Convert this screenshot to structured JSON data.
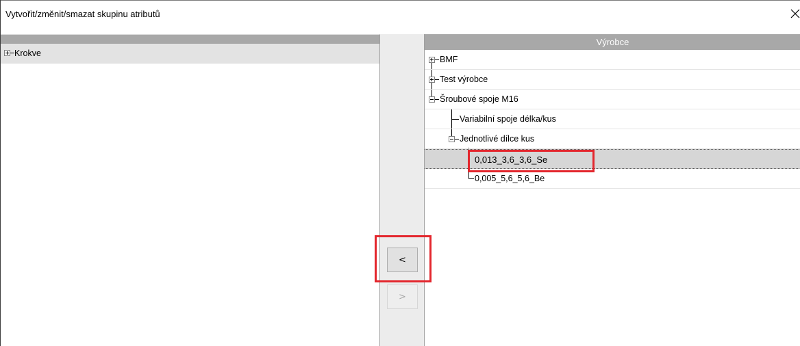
{
  "dialog": {
    "title": "Vytvořit/změnit/smazat skupinu atributů",
    "close_icon": "close-icon"
  },
  "left_panel": {
    "items": [
      {
        "label": "Krokve",
        "expanded": false
      }
    ]
  },
  "middle": {
    "move_left_label": "<",
    "move_right_label": ">",
    "move_right_enabled": false
  },
  "right_panel": {
    "header": "Výrobce",
    "items": [
      {
        "label": "BMF",
        "level": 0,
        "expander": "plus"
      },
      {
        "label": "Test výrobce",
        "level": 0,
        "expander": "plus"
      },
      {
        "label": "Šroubové spoje M16",
        "level": 0,
        "expander": "minus"
      },
      {
        "label": "Variabilní spoje délka/kus",
        "level": 1,
        "expander": "none"
      },
      {
        "label": "Jednotlivé dílce kus",
        "level": 1,
        "expander": "minus"
      },
      {
        "label": "0,013_3,6_3,6_Se",
        "level": 2,
        "expander": "none",
        "selected": true
      },
      {
        "label": "0,005_5,6_5,6_Be",
        "level": 2,
        "expander": "none"
      }
    ]
  },
  "colors": {
    "highlight": "#e3262d",
    "header_bg": "#a8a8a8",
    "selected_row_bg": "#d6d6d6"
  }
}
